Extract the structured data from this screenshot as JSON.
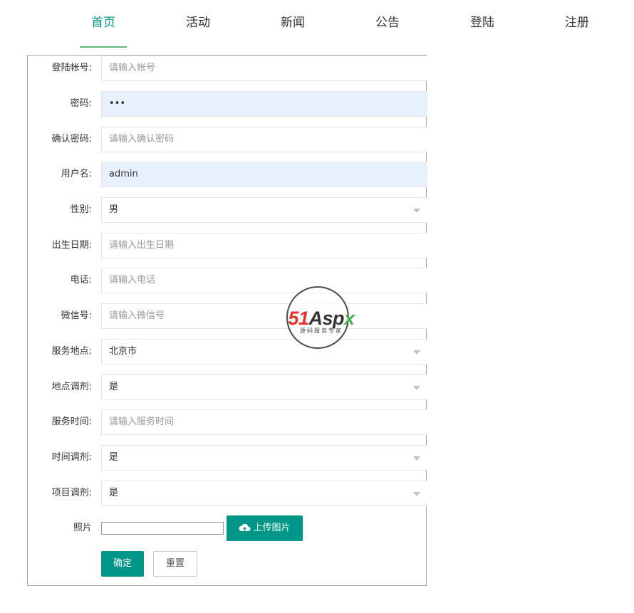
{
  "nav": {
    "items": [
      {
        "label": "首页",
        "active": true
      },
      {
        "label": "活动",
        "active": false
      },
      {
        "label": "新闻",
        "active": false
      },
      {
        "label": "公告",
        "active": false
      },
      {
        "label": "登陆",
        "active": false
      },
      {
        "label": "注册",
        "active": false
      }
    ],
    "accent_color": "#009688"
  },
  "form": {
    "account": {
      "label": "登陆帐号:",
      "placeholder": "请输入帐号",
      "value": ""
    },
    "password": {
      "label": "密码:",
      "value": "•••"
    },
    "confirm_password": {
      "label": "确认密码:",
      "placeholder": "请输入确认密码",
      "value": ""
    },
    "username": {
      "label": "用户名:",
      "value": "admin"
    },
    "gender": {
      "label": "性别:",
      "value": "男"
    },
    "birthdate": {
      "label": "出生日期:",
      "placeholder": "请输入出生日期",
      "value": ""
    },
    "phone": {
      "label": "电话:",
      "placeholder": "请输入电话",
      "value": ""
    },
    "wechat": {
      "label": "微信号:",
      "placeholder": "请输入微信号",
      "value": ""
    },
    "service_location": {
      "label": "服务地点:",
      "value": "北京市"
    },
    "location_adjust": {
      "label": "地点调剂:",
      "value": "是"
    },
    "service_time": {
      "label": "服务时间:",
      "placeholder": "请输入服务时间",
      "value": ""
    },
    "time_adjust": {
      "label": "时间调剂:",
      "value": "是"
    },
    "project_adjust": {
      "label": "项目调剂:",
      "value": "是"
    },
    "photo": {
      "label": "照片",
      "upload_label": "上传图片"
    },
    "submit_label": "确定",
    "reset_label": "重置"
  },
  "watermark": {
    "brand_red": "51",
    "brand_dark": "Asp",
    "brand_green": "x",
    "subtitle": "源码服务专家"
  }
}
